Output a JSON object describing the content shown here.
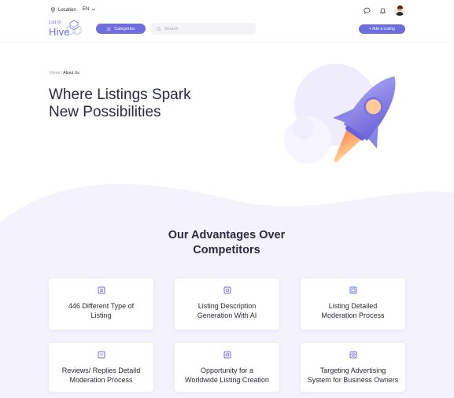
{
  "header": {
    "location_label": "Location",
    "language": "EN",
    "logo_small": "List in",
    "logo_big": "Hive",
    "categories_label": "Categories",
    "search_placeholder": "Search",
    "add_listing_label": "+ Add a Listing"
  },
  "breadcrumb": {
    "home": "Home",
    "separator": "/",
    "current": "About Us"
  },
  "hero": {
    "title_line1": "Where Listings Spark",
    "title_line2": "New Possibilities"
  },
  "advantages": {
    "title_line1": "Our Advantages Over",
    "title_line2": "Competitors",
    "items": [
      {
        "icon": "list-icon",
        "line1": "446 Different Type of",
        "line2": "Listing"
      },
      {
        "icon": "ai-chip-icon",
        "line1": "Listing Description",
        "line2": "Generation With AI"
      },
      {
        "icon": "document-check-icon",
        "line1": "Listing Detailed",
        "line2": "Moderation Process"
      },
      {
        "icon": "review-icon",
        "line1": "Reviews/ Replies Detaild",
        "line2": "Moderation Process"
      },
      {
        "icon": "globe-icon",
        "line1": "Opportunity for a",
        "line2": "Worldwide Listing Creation"
      },
      {
        "icon": "target-icon",
        "line1": "Targeting Advertising",
        "line2": "System for Business Owners"
      }
    ]
  },
  "colors": {
    "accent": "#6e6de0",
    "lavender_bg": "#f3f2fd",
    "text": "#2a2a40"
  }
}
